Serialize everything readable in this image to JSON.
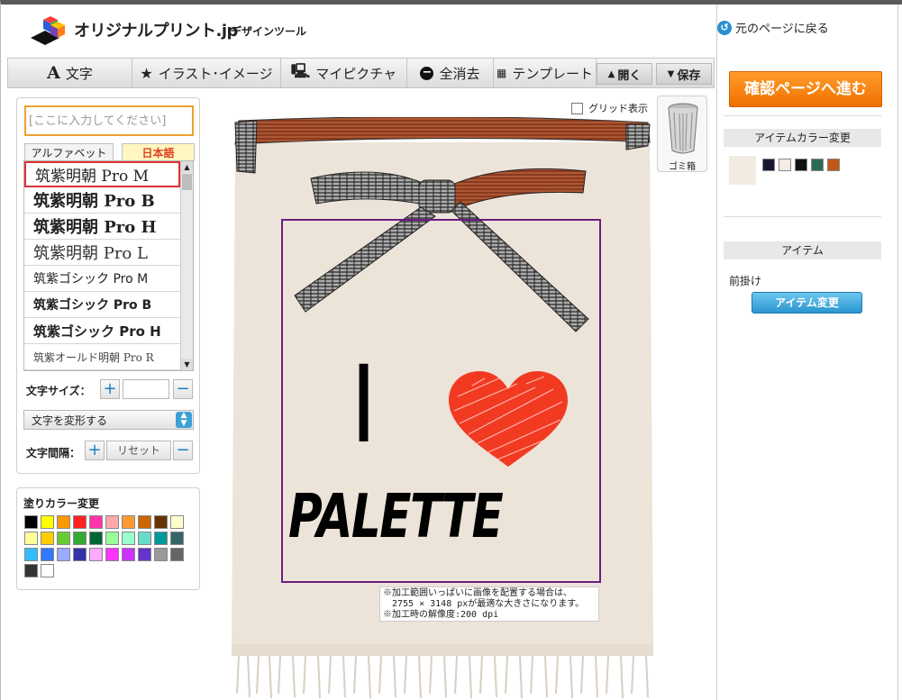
{
  "header": {
    "brand": "オリジナルプリント.jp",
    "subtitle": "デザインツール",
    "back_link": "元のページに戻る"
  },
  "toolbar": {
    "text": "文字",
    "illust": "イラスト･イメージ",
    "picture": "マイピクチャ",
    "clear": "全消去",
    "template": "テンプレート",
    "open": "開く",
    "save": "保存"
  },
  "left": {
    "text_placeholder": "[ここに入力してください]",
    "tabs": [
      "アルファベット",
      "日本語"
    ],
    "fonts": [
      "筑紫明朝 Pro M",
      "筑紫明朝 Pro B",
      "筑紫明朝 Pro H",
      "筑紫明朝 Pro L",
      "筑紫ゴシック Pro M",
      "筑紫ゴシック Pro B",
      "筑紫ゴシック Pro H",
      "筑紫オールド明朝 Pro R"
    ],
    "size_label": "文字サイズ：",
    "size_value": "",
    "transform_label": "文字を変形する",
    "spacing_label": "文字間隔：",
    "reset_label": "リセット",
    "fill_title": "塗りカラー変更",
    "palette": [
      "#000000",
      "#ffff00",
      "#ff9900",
      "#ff2222",
      "#ff33aa",
      "#ffaaaa",
      "#ff9933",
      "#cc6600",
      "#663300",
      "#ffffcc",
      "#ffff99",
      "#ffcc00",
      "#66cc33",
      "#33aa33",
      "#006633",
      "#99ff99",
      "#99ffcc",
      "#66ddcc",
      "#009999",
      "#336666",
      "#33bbff",
      "#3377ff",
      "#99aaff",
      "#3333aa",
      "#ffaaff",
      "#ff33ff",
      "#cc33ff",
      "#6633cc",
      "#999999",
      "#666666",
      "#333333",
      "#ffffff"
    ]
  },
  "canvas": {
    "grid_label": "グリッド表示",
    "trash_label": "ゴミ箱",
    "design_text_1": "I",
    "design_text_2": "PALETTE",
    "note": [
      "※加工範囲いっぱいに画像を配置する場合は、",
      "　2755 × 3148 pxが最適な大きさになります。",
      "※加工時の解像度:200 dpi"
    ]
  },
  "right": {
    "confirm_label": "確認ページへ進む",
    "item_color_title": "アイテムカラー変更",
    "item_colors": [
      "#1b1733",
      "#f3ece3",
      "#111111",
      "#2b6a56",
      "#c2571a"
    ],
    "item_title": "アイテム",
    "item_name": "前掛け",
    "item_change": "アイテム変更"
  }
}
